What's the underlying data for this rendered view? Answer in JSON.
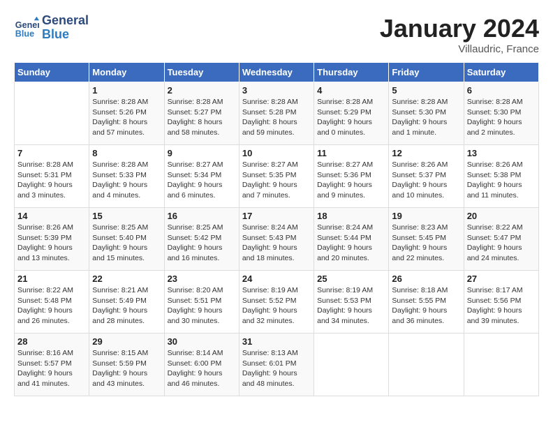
{
  "header": {
    "logo_line1": "General",
    "logo_line2": "Blue",
    "month": "January 2024",
    "location": "Villaudric, France"
  },
  "days_of_week": [
    "Sunday",
    "Monday",
    "Tuesday",
    "Wednesday",
    "Thursday",
    "Friday",
    "Saturday"
  ],
  "weeks": [
    [
      {
        "day": "",
        "info": ""
      },
      {
        "day": "1",
        "info": "Sunrise: 8:28 AM\nSunset: 5:26 PM\nDaylight: 8 hours\nand 57 minutes."
      },
      {
        "day": "2",
        "info": "Sunrise: 8:28 AM\nSunset: 5:27 PM\nDaylight: 8 hours\nand 58 minutes."
      },
      {
        "day": "3",
        "info": "Sunrise: 8:28 AM\nSunset: 5:28 PM\nDaylight: 8 hours\nand 59 minutes."
      },
      {
        "day": "4",
        "info": "Sunrise: 8:28 AM\nSunset: 5:29 PM\nDaylight: 9 hours\nand 0 minutes."
      },
      {
        "day": "5",
        "info": "Sunrise: 8:28 AM\nSunset: 5:30 PM\nDaylight: 9 hours\nand 1 minute."
      },
      {
        "day": "6",
        "info": "Sunrise: 8:28 AM\nSunset: 5:30 PM\nDaylight: 9 hours\nand 2 minutes."
      }
    ],
    [
      {
        "day": "7",
        "info": "Sunrise: 8:28 AM\nSunset: 5:31 PM\nDaylight: 9 hours\nand 3 minutes."
      },
      {
        "day": "8",
        "info": "Sunrise: 8:28 AM\nSunset: 5:33 PM\nDaylight: 9 hours\nand 4 minutes."
      },
      {
        "day": "9",
        "info": "Sunrise: 8:27 AM\nSunset: 5:34 PM\nDaylight: 9 hours\nand 6 minutes."
      },
      {
        "day": "10",
        "info": "Sunrise: 8:27 AM\nSunset: 5:35 PM\nDaylight: 9 hours\nand 7 minutes."
      },
      {
        "day": "11",
        "info": "Sunrise: 8:27 AM\nSunset: 5:36 PM\nDaylight: 9 hours\nand 9 minutes."
      },
      {
        "day": "12",
        "info": "Sunrise: 8:26 AM\nSunset: 5:37 PM\nDaylight: 9 hours\nand 10 minutes."
      },
      {
        "day": "13",
        "info": "Sunrise: 8:26 AM\nSunset: 5:38 PM\nDaylight: 9 hours\nand 11 minutes."
      }
    ],
    [
      {
        "day": "14",
        "info": "Sunrise: 8:26 AM\nSunset: 5:39 PM\nDaylight: 9 hours\nand 13 minutes."
      },
      {
        "day": "15",
        "info": "Sunrise: 8:25 AM\nSunset: 5:40 PM\nDaylight: 9 hours\nand 15 minutes."
      },
      {
        "day": "16",
        "info": "Sunrise: 8:25 AM\nSunset: 5:42 PM\nDaylight: 9 hours\nand 16 minutes."
      },
      {
        "day": "17",
        "info": "Sunrise: 8:24 AM\nSunset: 5:43 PM\nDaylight: 9 hours\nand 18 minutes."
      },
      {
        "day": "18",
        "info": "Sunrise: 8:24 AM\nSunset: 5:44 PM\nDaylight: 9 hours\nand 20 minutes."
      },
      {
        "day": "19",
        "info": "Sunrise: 8:23 AM\nSunset: 5:45 PM\nDaylight: 9 hours\nand 22 minutes."
      },
      {
        "day": "20",
        "info": "Sunrise: 8:22 AM\nSunset: 5:47 PM\nDaylight: 9 hours\nand 24 minutes."
      }
    ],
    [
      {
        "day": "21",
        "info": "Sunrise: 8:22 AM\nSunset: 5:48 PM\nDaylight: 9 hours\nand 26 minutes."
      },
      {
        "day": "22",
        "info": "Sunrise: 8:21 AM\nSunset: 5:49 PM\nDaylight: 9 hours\nand 28 minutes."
      },
      {
        "day": "23",
        "info": "Sunrise: 8:20 AM\nSunset: 5:51 PM\nDaylight: 9 hours\nand 30 minutes."
      },
      {
        "day": "24",
        "info": "Sunrise: 8:19 AM\nSunset: 5:52 PM\nDaylight: 9 hours\nand 32 minutes."
      },
      {
        "day": "25",
        "info": "Sunrise: 8:19 AM\nSunset: 5:53 PM\nDaylight: 9 hours\nand 34 minutes."
      },
      {
        "day": "26",
        "info": "Sunrise: 8:18 AM\nSunset: 5:55 PM\nDaylight: 9 hours\nand 36 minutes."
      },
      {
        "day": "27",
        "info": "Sunrise: 8:17 AM\nSunset: 5:56 PM\nDaylight: 9 hours\nand 39 minutes."
      }
    ],
    [
      {
        "day": "28",
        "info": "Sunrise: 8:16 AM\nSunset: 5:57 PM\nDaylight: 9 hours\nand 41 minutes."
      },
      {
        "day": "29",
        "info": "Sunrise: 8:15 AM\nSunset: 5:59 PM\nDaylight: 9 hours\nand 43 minutes."
      },
      {
        "day": "30",
        "info": "Sunrise: 8:14 AM\nSunset: 6:00 PM\nDaylight: 9 hours\nand 46 minutes."
      },
      {
        "day": "31",
        "info": "Sunrise: 8:13 AM\nSunset: 6:01 PM\nDaylight: 9 hours\nand 48 minutes."
      },
      {
        "day": "",
        "info": ""
      },
      {
        "day": "",
        "info": ""
      },
      {
        "day": "",
        "info": ""
      }
    ]
  ]
}
